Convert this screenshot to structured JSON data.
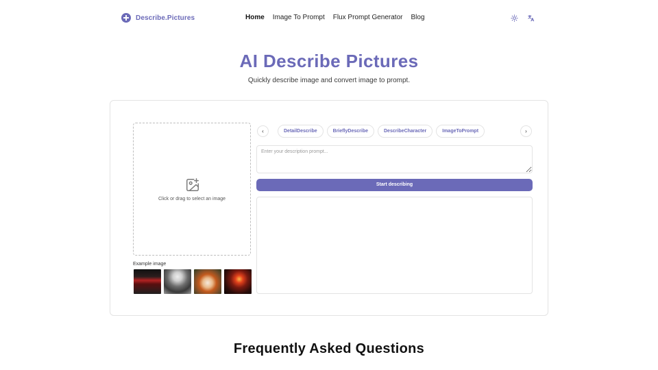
{
  "header": {
    "brand": "Describe.Pictures",
    "nav": [
      "Home",
      "Image To Prompt",
      "Flux Prompt Generator",
      "Blog"
    ],
    "active_nav": "Home",
    "icons": [
      "sun-icon",
      "translate-icon"
    ]
  },
  "hero": {
    "title": "AI Describe Pictures",
    "subtitle": "Quickly describe image and convert image to prompt."
  },
  "upload": {
    "hint": "Click or drag to select an image",
    "example_label": "Example image",
    "examples": [
      "example-image-1",
      "example-image-2",
      "example-image-3",
      "example-image-4"
    ]
  },
  "tabs": [
    "DetailDescribe",
    "BrieflyDescribe",
    "DescribeCharacter",
    "ImageToPrompt"
  ],
  "prompt": {
    "placeholder": "Enter your description prompt...",
    "value": ""
  },
  "start_button": "Start describing",
  "faq": {
    "title": "Frequently Asked Questions"
  },
  "colors": {
    "accent": "#6b6ab8",
    "border": "#e3e3e3",
    "text": "#1f2937"
  }
}
